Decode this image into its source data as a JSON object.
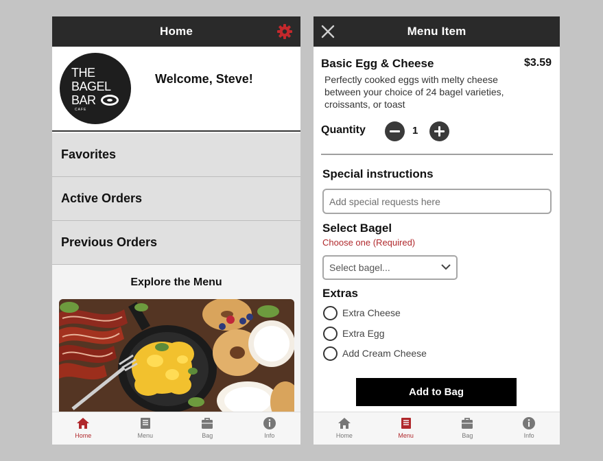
{
  "home": {
    "title": "Home",
    "logo": {
      "line1": "THE",
      "line2": "BAGEL",
      "line3": "BAR",
      "line4": "CAFE"
    },
    "welcome": "Welcome, Steve!",
    "nav": [
      "Favorites",
      "Active Orders",
      "Previous Orders"
    ],
    "explore_title": "Explore the Menu",
    "icons": {
      "settings": "gear-icon"
    },
    "accent_color": "#b0282c"
  },
  "menu_item": {
    "title": "Menu Item",
    "name": "Basic Egg & Cheese",
    "price": "$3.59",
    "description": "Perfectly cooked eggs with melty cheese between your choice of 24 bagel varieties, croissants, or toast",
    "quantity_label": "Quantity",
    "quantity": "1",
    "special_label": "Special instructions",
    "special_placeholder": "Add special requests here",
    "bagel_label": "Select Bagel",
    "bagel_required": "Choose one (Required)",
    "bagel_placeholder": "Select bagel...",
    "extras_label": "Extras",
    "extras": [
      "Extra Cheese",
      "Extra Egg",
      "Add Cream Cheese"
    ],
    "add_button": "Add to Bag"
  },
  "tabs": {
    "labels": [
      "Home",
      "Menu",
      "Bag",
      "Info"
    ],
    "home_screen_active": "Home",
    "menu_screen_active": "Menu"
  }
}
